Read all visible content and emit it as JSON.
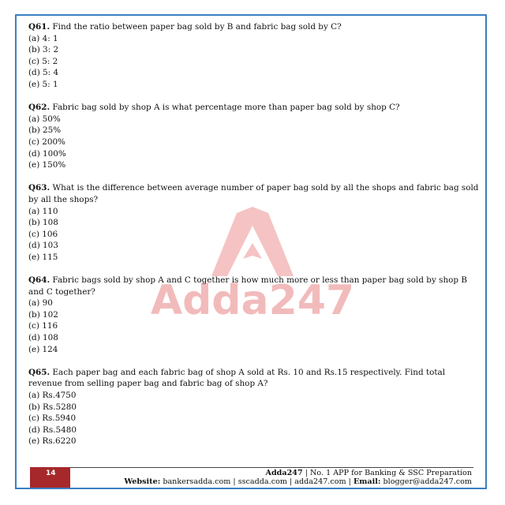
{
  "watermark": {
    "text": "Adda247",
    "color": "#e8a0a0"
  },
  "questions": [
    {
      "number": "Q61.",
      "text": "Find the ratio between paper bag sold by B and fabric bag sold by C?",
      "options": [
        "(a) 4: 1",
        "(b) 3: 2",
        "(c) 5: 2",
        "(d) 5: 4",
        "(e) 5: 1"
      ]
    },
    {
      "number": "Q62.",
      "text": "Fabric bag sold by shop A is what percentage more than paper bag sold by shop C?",
      "options": [
        "(a) 50%",
        "(b) 25%",
        "(c) 200%",
        "(d) 100%",
        "(e) 150%"
      ]
    },
    {
      "number": "Q63.",
      "text": "What is the difference between average number of paper bag sold by all the shops and fabric bag sold by all the shops?",
      "options": [
        "(a) 110",
        "(b) 108",
        "(c) 106",
        "(d) 103",
        "(e) 115"
      ]
    },
    {
      "number": "Q64.",
      "text": "Fabric bags sold by shop A and C together is how much more or less than paper bag sold by shop B and C together?",
      "options": [
        "(a) 90",
        "(b) 102",
        "(c) 116",
        "(d) 108",
        "(e) 124"
      ]
    },
    {
      "number": "Q65.",
      "text": "Each paper bag and each fabric bag of shop A sold at Rs. 10 and Rs.15 respectively. Find total revenue from selling paper bag and fabric bag of shop A?",
      "options": [
        "(a) Rs.4750",
        "(b) Rs.5280",
        "(c) Rs.5940",
        "(d) Rs.5480",
        "(e) Rs.6220"
      ]
    }
  ],
  "footer": {
    "page_number": "14",
    "brand": "Adda247",
    "tagline": "| No. 1 APP for Banking & SSC Preparation",
    "website_label": "Website:",
    "websites": "bankersadda.com | sscadda.com | adda247.com |",
    "email_label": "Email:",
    "email": "blogger@adda247.com",
    "badge_color": "#a6282b",
    "frame_color": "#3a7fc1"
  }
}
